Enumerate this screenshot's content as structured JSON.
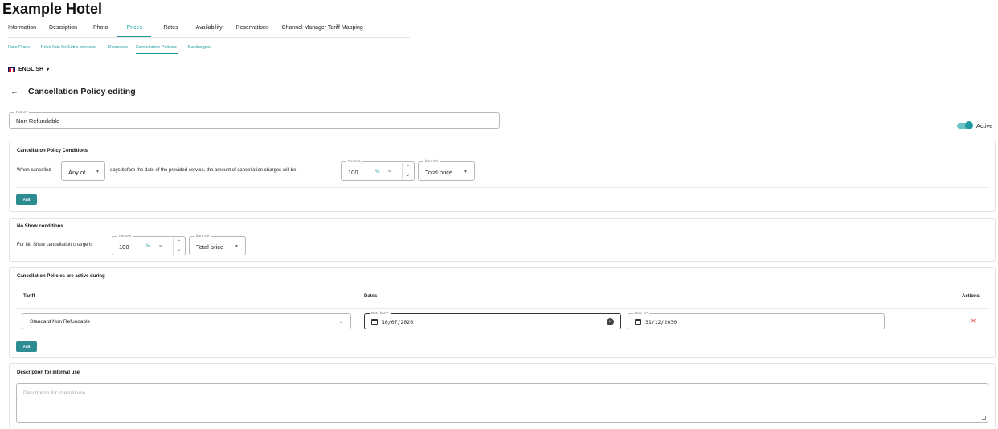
{
  "hotel_name": "Example Hotel",
  "main_tabs": [
    {
      "label": "Information"
    },
    {
      "label": "Description"
    },
    {
      "label": "Photo"
    },
    {
      "label": "Prices"
    },
    {
      "label": "Rates"
    },
    {
      "label": "Availability"
    },
    {
      "label": "Reservations"
    },
    {
      "label": "Channel Manager Tariff Mapping"
    }
  ],
  "sub_tabs": [
    {
      "label": "Rate Plans"
    },
    {
      "label": "Price-lists for Extra services"
    },
    {
      "label": "Discounts"
    },
    {
      "label": "Cancellation Policies"
    },
    {
      "label": "Surcharges"
    }
  ],
  "language": "ENGLISH",
  "page_title": "Cancellation Policy editing",
  "name_field": {
    "label": "Name*",
    "value": "Non Refundable"
  },
  "active_toggle": {
    "label": "Active",
    "state": "on"
  },
  "conditions": {
    "title": "Cancellation Policy Conditions",
    "when_cancelled": "When cancelled",
    "any_of": "Any of",
    "days_text": "days before the date of the provided service, the amount of cancellation charges will be",
    "percent_label": "Percent",
    "percent_value": "100",
    "percent_sign": "%",
    "from_label": "from the",
    "from_value": "Total price",
    "add_label": "Add"
  },
  "no_show": {
    "title": "No Show conditions",
    "text": "For No Show cancellation charge is",
    "percent_label": "Percent",
    "percent_value": "100",
    "percent_sign": "%",
    "from_label": "from the",
    "from_value": "Total price"
  },
  "active_during": {
    "title": "Cancellation Policies are active during",
    "col_tariff": "Tariff",
    "col_dates": "Dates",
    "col_actions": "Actions",
    "tariff_value": "Standard Non Refundable",
    "date_from_label": "Date from*",
    "date_from_value": "16/07/2026",
    "date_to_label": "Date to*",
    "date_to_value": "31/12/2030",
    "add_label": "Add"
  },
  "description": {
    "title": "Description for internal use",
    "placeholder": "Description for internal use"
  },
  "colors": {
    "accent": "#1f9aa0",
    "button": "#2c8c91",
    "danger": "#e53935"
  }
}
